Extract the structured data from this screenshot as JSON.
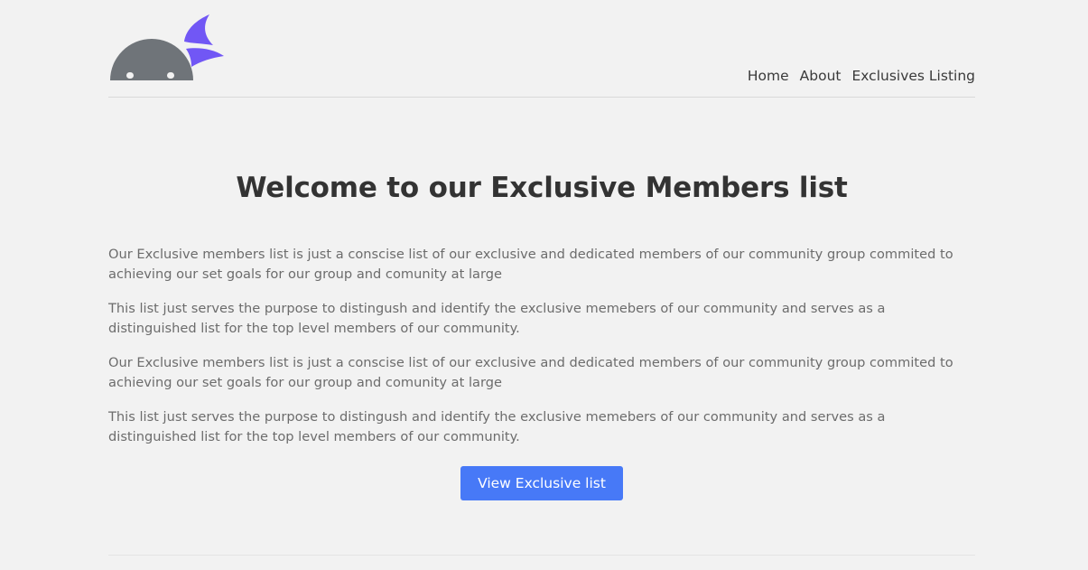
{
  "header": {
    "logo_icon": "ninja-head-logo-icon",
    "nav": {
      "home": "Home",
      "about": "About",
      "listing": "Exclusives Listing"
    }
  },
  "main": {
    "title": "Welcome to our Exclusive Members list",
    "paragraphs": [
      "Our Exclusive members list is just a conscise list of our exclusive and dedicated members of our community group commited to achieving our set goals for our group and comunity at large",
      "This list just serves the purpose to distingush and identify the exclusive memebers of our community and serves as a distinguished list for the top level members of our community.",
      "Our Exclusive members list is just a conscise list of our exclusive and dedicated members of our community group commited to achieving our set goals for our group and comunity at large",
      "This list just serves the purpose to distingush and identify the exclusive memebers of our community and serves as a distinguished list for the top level members of our community."
    ],
    "cta_label": "View Exclusive list"
  },
  "colors": {
    "background": "#f2f2f2",
    "accent": "#4779f7",
    "logo_gray": "#6f7479",
    "logo_purple": "#7157f5"
  }
}
